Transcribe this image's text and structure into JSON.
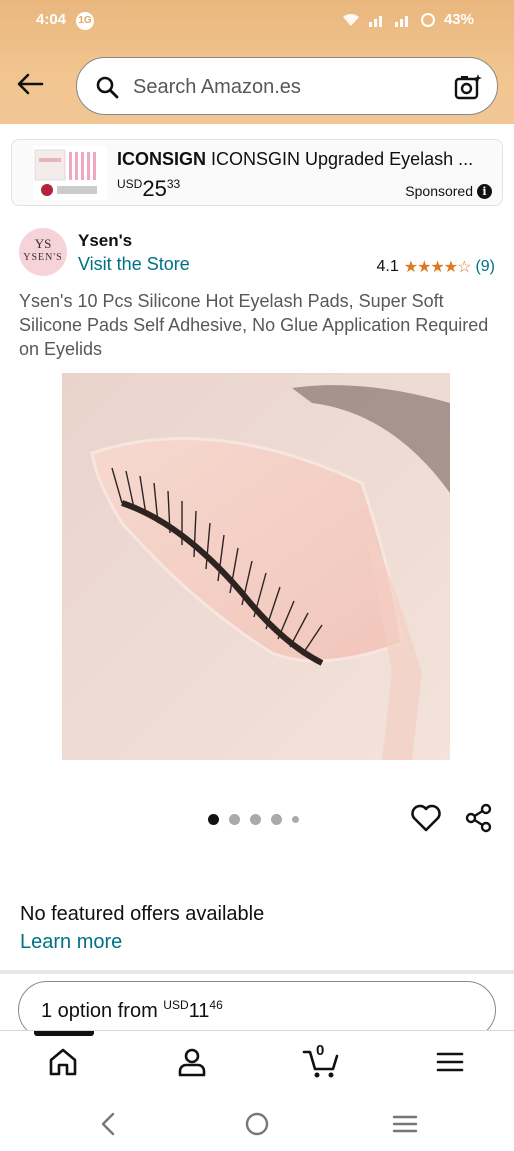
{
  "status_bar": {
    "time": "4:04",
    "notification_badge": "1G",
    "battery": "43%"
  },
  "search": {
    "placeholder": "Search Amazon.es"
  },
  "sponsored_ad": {
    "brand": "ICONSIGN",
    "title": "ICONSGIN Upgraded Eyelash ...",
    "price_currency": "USD",
    "price_whole": "25",
    "price_fraction": "33",
    "label": "Sponsored"
  },
  "product": {
    "brand_logo_initials": "YS",
    "brand_logo_name": "YSEN'S",
    "brand_name": "Ysen's",
    "visit_store": "Visit the Store",
    "rating_value": "4.1",
    "stars": "★★★★☆",
    "rating_count": "(9)",
    "title": "Ysen's 10 Pcs Silicone Hot Eyelash Pads, Super Soft Silicone Pads Self Adhesive, No Glue Application Required on Eyelids"
  },
  "carousel": {
    "image_count": 5,
    "active_index": 0
  },
  "offers": {
    "no_offers": "No featured offers available",
    "learn_more": "Learn more",
    "options_prefix": "1 option from",
    "options_currency": "USD",
    "options_whole": "11",
    "options_fraction": "46"
  },
  "bottom_nav": {
    "cart_count": "0"
  },
  "colors": {
    "header_gradient_top": "#e9b77e",
    "link": "#007185",
    "star": "#de7921"
  }
}
